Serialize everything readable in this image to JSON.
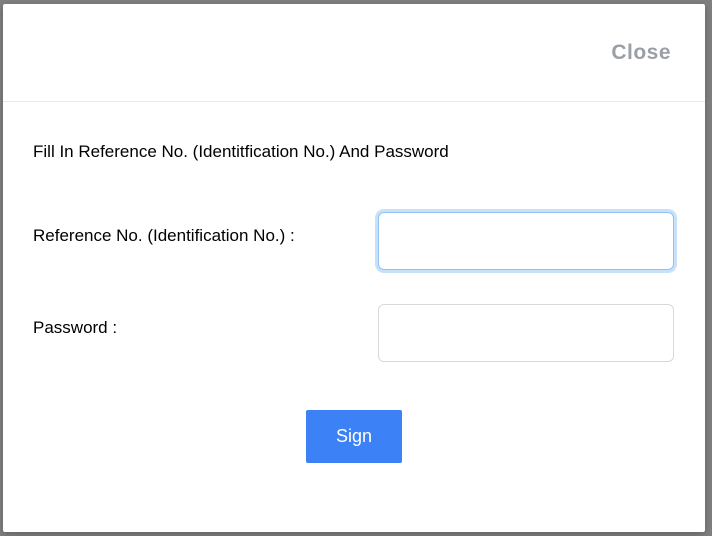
{
  "header": {
    "close_label": "Close"
  },
  "form": {
    "instruction": "Fill In Reference No. (Identitfication No.) And Password",
    "reference_label": "Reference No. (Identification No.) :",
    "reference_value": "",
    "password_label": "Password :",
    "password_value": "",
    "sign_label": "Sign"
  }
}
